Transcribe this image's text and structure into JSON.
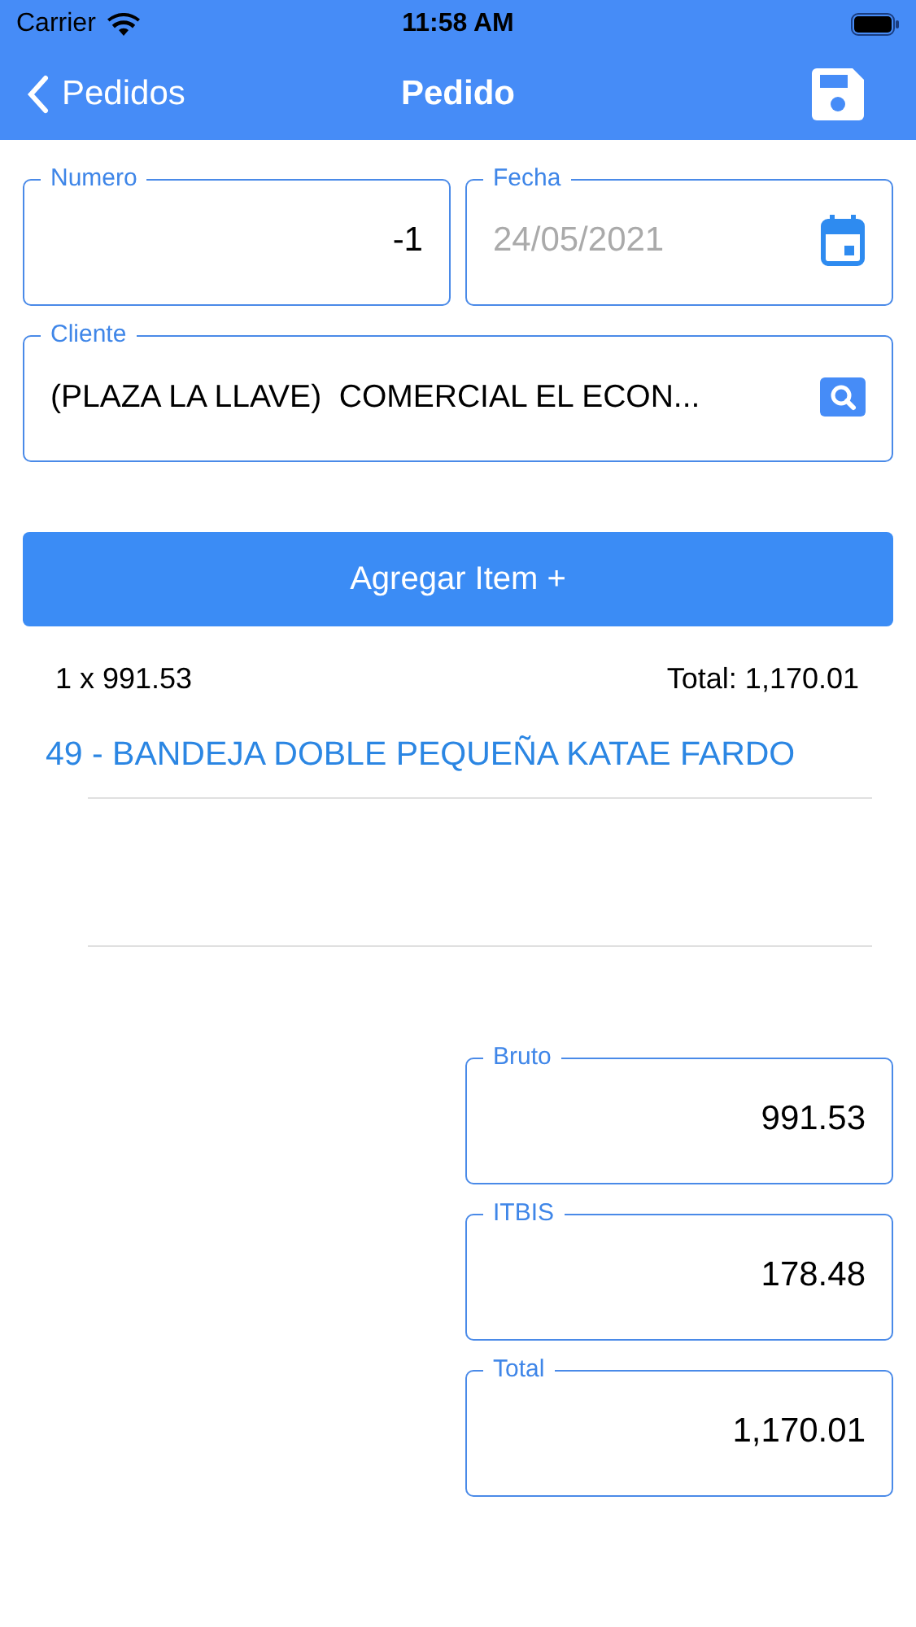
{
  "status_bar": {
    "carrier": "Carrier",
    "time": "11:58 AM"
  },
  "nav": {
    "back": "Pedidos",
    "title": "Pedido"
  },
  "fields": [
    {
      "kind": "number",
      "label": "Numero",
      "value": "-1"
    },
    {
      "kind": "date",
      "label": "Fecha",
      "placeholder": "24/05/2021"
    },
    {
      "kind": "search",
      "label": "Cliente",
      "value": "(PLAZA LA LLAVE)  COMERCIAL EL ECON..."
    }
  ],
  "add_button": "Agregar Item +",
  "items": [
    {
      "quantity_price": "1 x 991.53",
      "total": "Total: 1,170.01",
      "name": "49 - BANDEJA DOBLE PEQUEÑA KATAE FARDO"
    }
  ],
  "totals": [
    {
      "label": "Bruto",
      "value": "991.53"
    },
    {
      "label": "ITBIS",
      "value": "178.48"
    },
    {
      "label": "Total",
      "value": "1,170.01"
    }
  ]
}
